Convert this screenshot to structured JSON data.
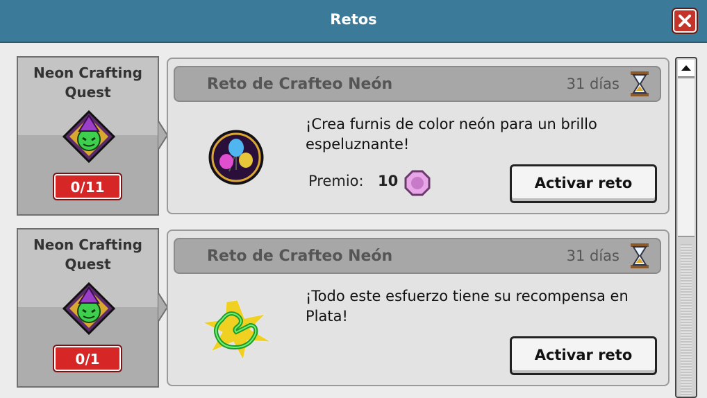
{
  "window": {
    "title": "Retos",
    "close_icon": "close-icon"
  },
  "quests": [
    {
      "side_title": "Neon Crafting Quest",
      "progress": "0/11",
      "title": "Reto de Crafteo Neón",
      "days": "31 días",
      "description": "¡Crea furnis de color neón para un brillo espeluznante!",
      "prize_label": "Premio:",
      "prize_value": "10",
      "button": "Activar reto",
      "badge_icon": "neon-balloons-badge-icon"
    },
    {
      "side_title": "Neon Crafting Quest",
      "progress": "0/1",
      "title": "Reto de Crafteo Neón",
      "days": "31 días",
      "description": "¡Todo este esfuerzo tiene su recompensa en Plata!",
      "button": "Activar reto",
      "badge_icon": "neon-duck-star-icon"
    }
  ],
  "colors": {
    "titlebar": "#3c7a99",
    "counter": "#d62626",
    "close": "#c4342a"
  }
}
